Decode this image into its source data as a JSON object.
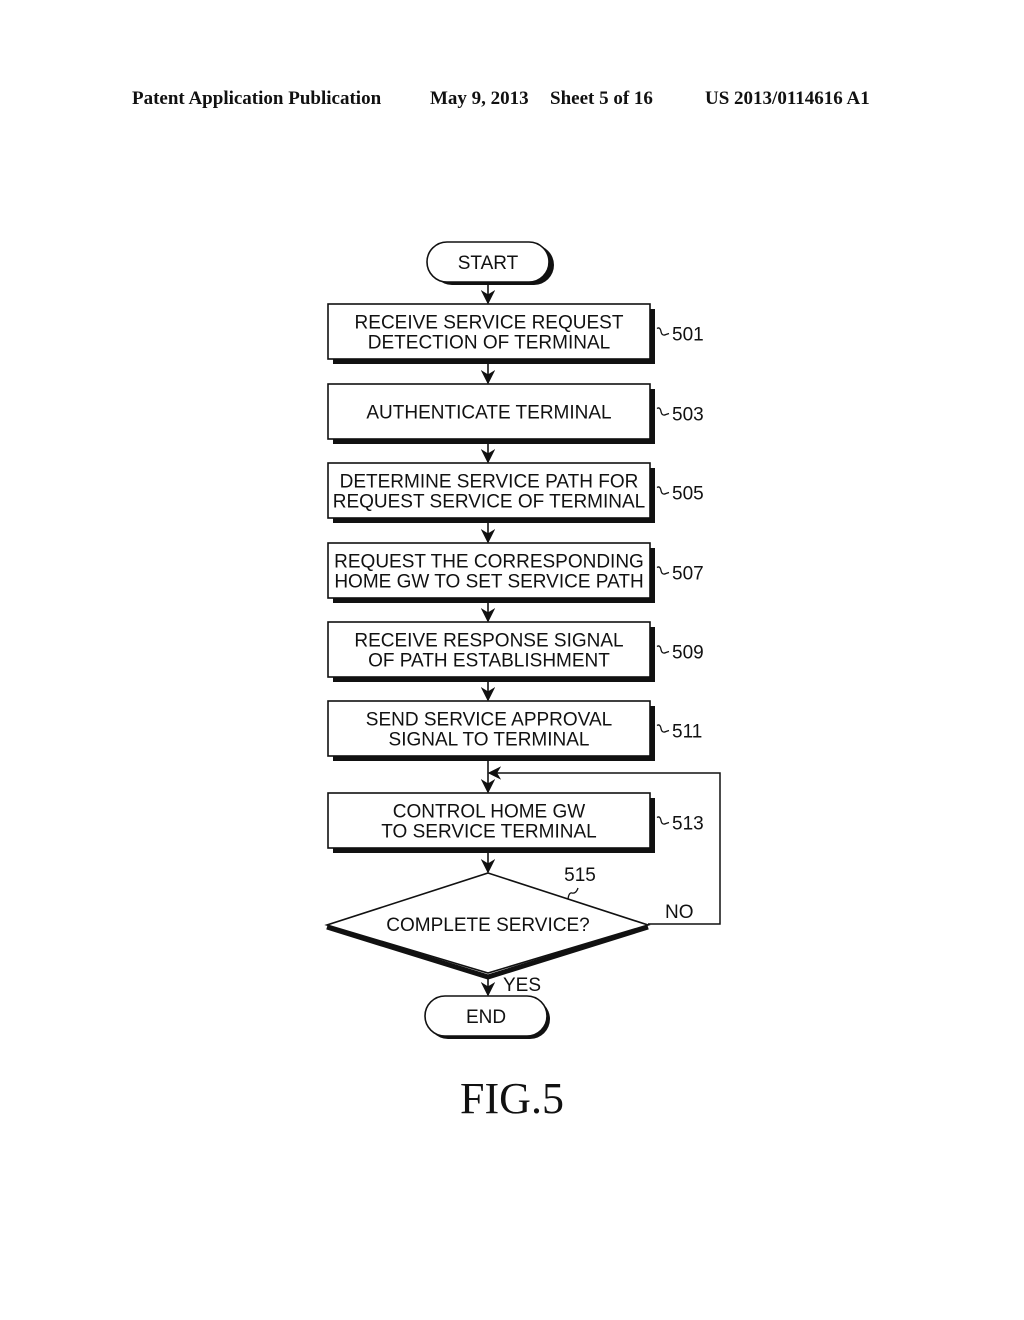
{
  "header": {
    "publication": "Patent Application Publication",
    "date": "May 9, 2013",
    "sheet": "Sheet 5 of 16",
    "patent_number": "US 2013/0114616 A1"
  },
  "flowchart": {
    "start": "START",
    "end": "END",
    "steps": [
      {
        "id": "501",
        "lines": [
          "RECEIVE SERVICE REQUEST",
          "DETECTION OF TERMINAL"
        ]
      },
      {
        "id": "503",
        "lines": [
          "AUTHENTICATE TERMINAL"
        ]
      },
      {
        "id": "505",
        "lines": [
          "DETERMINE SERVICE PATH FOR",
          "REQUEST SERVICE OF TERMINAL"
        ]
      },
      {
        "id": "507",
        "lines": [
          "REQUEST THE CORRESPONDING",
          "HOME GW TO SET SERVICE PATH"
        ]
      },
      {
        "id": "509",
        "lines": [
          "RECEIVE RESPONSE SIGNAL",
          "OF PATH ESTABLISHMENT"
        ]
      },
      {
        "id": "511",
        "lines": [
          "SEND SERVICE APPROVAL",
          "SIGNAL TO TERMINAL"
        ]
      },
      {
        "id": "513",
        "lines": [
          "CONTROL HOME GW",
          "TO SERVICE TERMINAL"
        ]
      }
    ],
    "decision": {
      "id": "515",
      "text": "COMPLETE SERVICE?",
      "yes_label": "YES",
      "no_label": "NO"
    }
  },
  "figure_label": "FIG.5"
}
